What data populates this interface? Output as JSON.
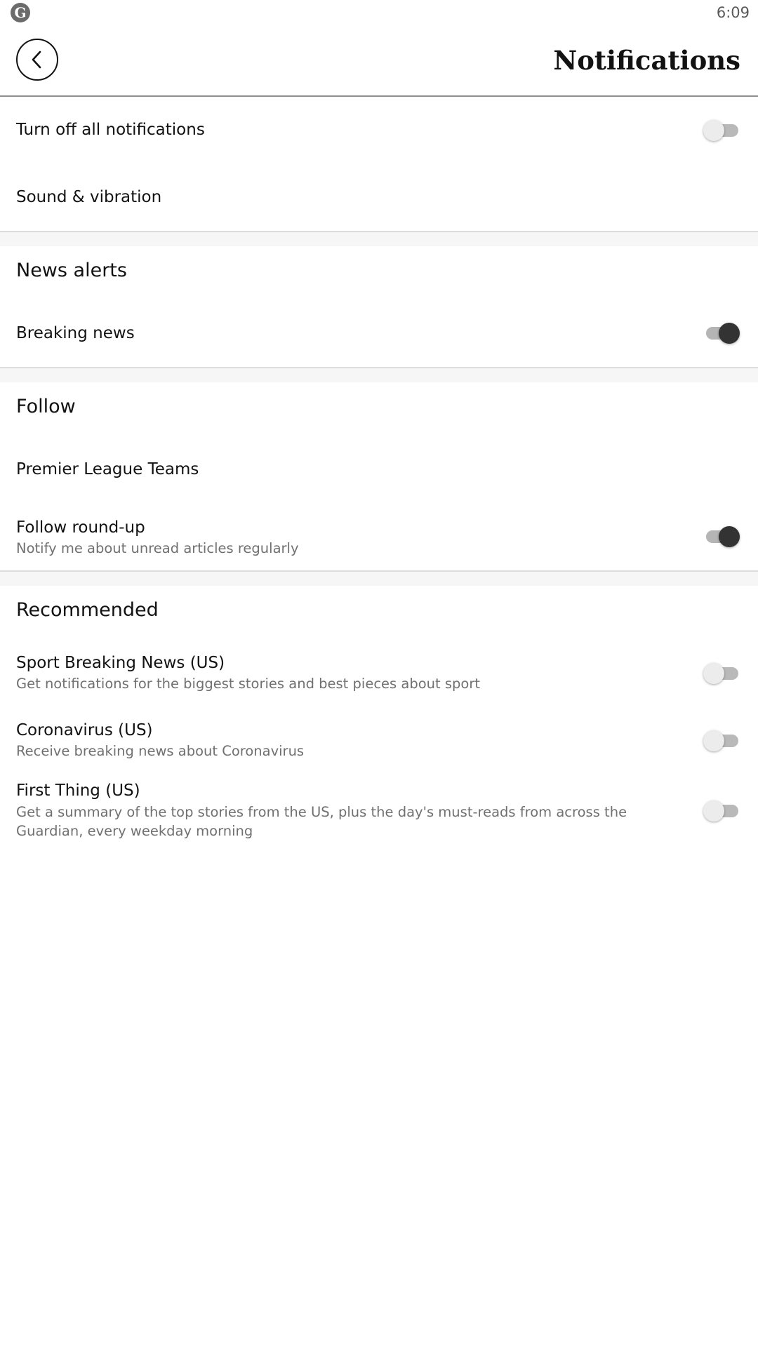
{
  "status_bar": {
    "time": "6:09",
    "logo_letter": "G"
  },
  "header": {
    "title": "Notifications",
    "back_icon": "chevron-left-icon"
  },
  "general": {
    "turn_off_all": {
      "label": "Turn off all notifications",
      "enabled": false
    },
    "sound_vibration": {
      "label": "Sound & vibration"
    }
  },
  "news_alerts": {
    "title": "News alerts",
    "breaking_news": {
      "label": "Breaking news",
      "enabled": true
    }
  },
  "follow": {
    "title": "Follow",
    "premier_league": {
      "label": "Premier League Teams"
    },
    "round_up": {
      "label": "Follow round-up",
      "description": "Notify me about unread articles regularly",
      "enabled": true
    }
  },
  "recommended": {
    "title": "Recommended",
    "items": [
      {
        "label": "Sport Breaking News (US)",
        "description": "Get notifications for the biggest stories and best pieces about sport",
        "enabled": false
      },
      {
        "label": "Coronavirus (US)",
        "description": "Receive breaking news about Coronavirus",
        "enabled": false
      },
      {
        "label": "First Thing (US)",
        "description": "Get a summary of the top stories from the US, plus the day's must-reads from across the Guardian, every weekday morning",
        "enabled": false
      }
    ]
  },
  "colors": {
    "toggle_on_thumb": "#333333",
    "toggle_off_thumb": "#ececec",
    "divider": "#dcdcdc"
  }
}
